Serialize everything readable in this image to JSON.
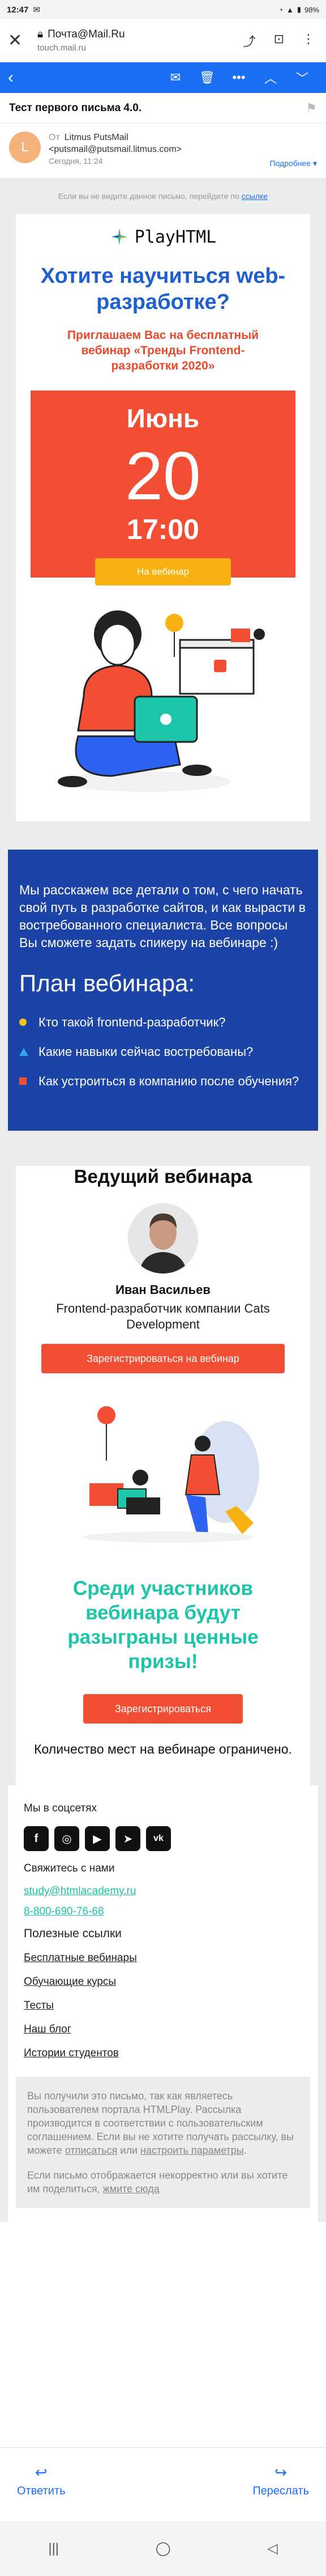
{
  "status_bar": {
    "time": "12:47",
    "icons": [
      "mail-icon",
      "wifi-icon",
      "signal-icon",
      "battery-icon"
    ],
    "battery": "98%"
  },
  "browser": {
    "title": "Почта@Mail.Ru",
    "url": "touch.mail.ru"
  },
  "mail": {
    "subject": "Тест первого письма 4.0.",
    "from_label": "От",
    "sender_name": "Litmus PutsMail",
    "sender_email": "<putsmail@putsmail.litmus.com>",
    "date": "Сегодня, 11:24",
    "details": "Подробнее"
  },
  "email": {
    "notice_text": "Если вы не видите данное письмо, перейдите по",
    "notice_link": "ссылке",
    "logo": "PlayHTML",
    "headline": "Хотите научиться web-разработке?",
    "invite": "Приглашаем Вас на бесплатный вебинар «Тренды Frontend-разработки 2020»",
    "month": "Июнь",
    "day": "20",
    "time": "17:00",
    "webinar_button": "На вебинар",
    "intro": "Мы расскажем все детали о том, с чего начать свой путь в разработке сайтов, и как вырасти в востребованного специалиста. Все вопросы Вы сможете задать спикеру на вебинаре :)",
    "plan_title": "План вебинара:",
    "plan_items": [
      "Кто такой frontend-разработчик?",
      "Какие навыки сейчас востребованы?",
      "Как устроиться в компанию после обучения?"
    ],
    "host_title": "Ведущий вебинара",
    "host_name": "Иван Васильев",
    "host_role": "Frontend-разработчик компании Cats Development",
    "register_webinar": "Зарегистрироваться на вебинар",
    "prizes": "Среди участников вебинара будут разыграны ценные призы!",
    "register": "Зарегистрироваться",
    "limited": "Количество мест на вебинаре ограничено.",
    "social_title": "Мы в соцсетях",
    "social_icons": [
      "facebook-icon",
      "instagram-icon",
      "youtube-icon",
      "telegram-icon",
      "vk-icon"
    ],
    "contact_title": "Свяжитесь с нами",
    "contact_email": "study@htmlacademy.ru",
    "contact_phone": "8-800-690-76-68",
    "links_title": "Полезные ссылки",
    "links": [
      "Бесплатные вебинары",
      "Обучающие курсы",
      "Тесты",
      "Наш блог",
      "Истории студентов"
    ],
    "footer_1a": "Вы получили это письмо, так как являетесь пользователем портала HTMLPlay. Рассылка производится в соответствии с пользовательским соглашением. Если вы не хотите получать рассылку, вы можете",
    "footer_unsub": "отписаться",
    "footer_or": "или",
    "footer_params": "настроить параметры",
    "footer_2": "Если письмо отображается некорректно или вы хотите им поделиться,",
    "footer_view": "жмите сюда"
  },
  "actions": {
    "reply": "Ответить",
    "forward": "Переслать"
  },
  "colors": {
    "mail_blue": "#1a6ff2",
    "accent_red": "#f24e33",
    "deep_blue": "#1c43a8",
    "teal": "#1cc4a8",
    "yellow": "#f7b212"
  }
}
